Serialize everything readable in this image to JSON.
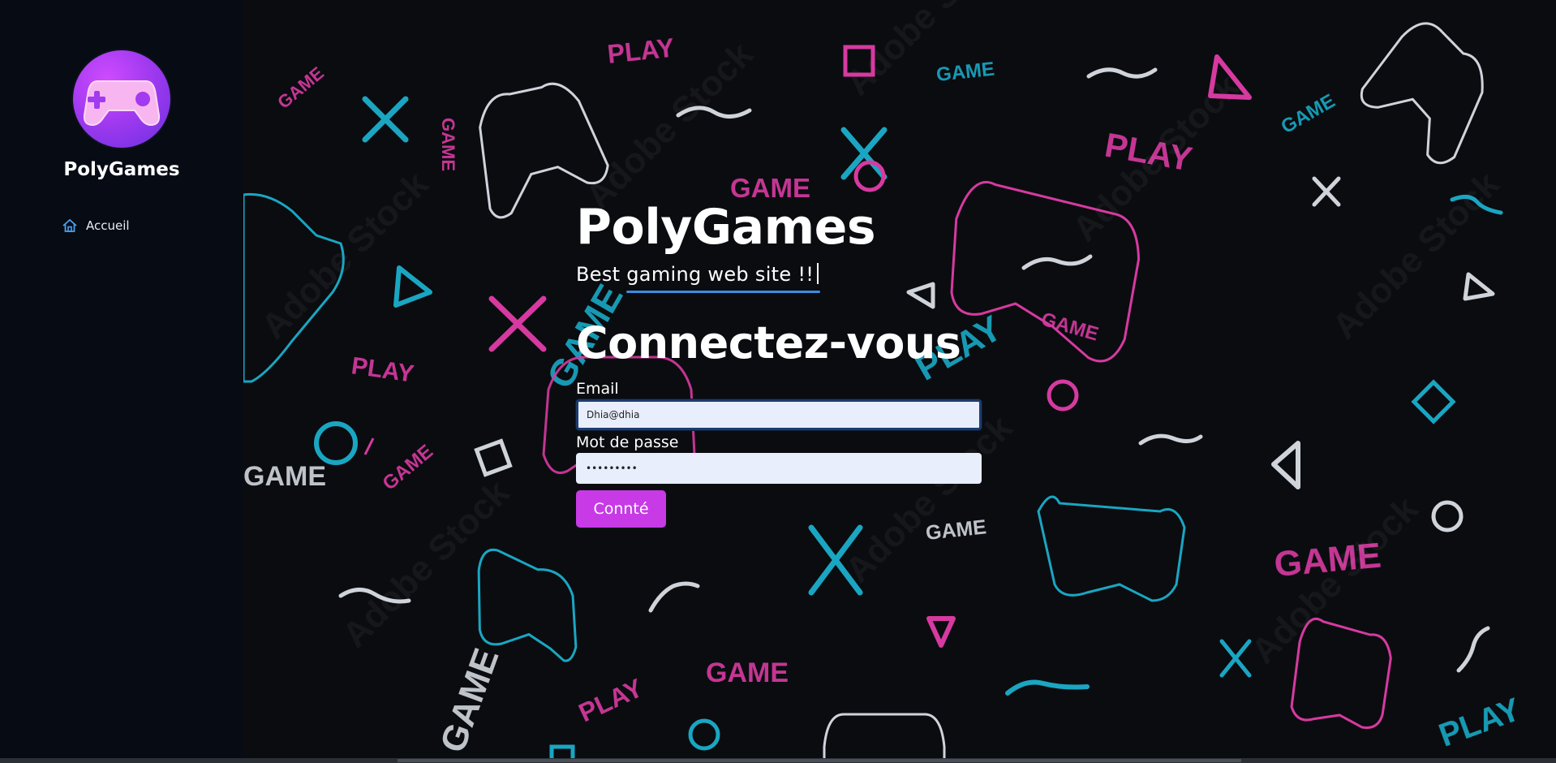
{
  "sidebar": {
    "brand": "PolyGames",
    "nav": [
      {
        "label": "Accueil",
        "icon": "home-icon"
      }
    ]
  },
  "hero": {
    "title": "PolyGames",
    "tagline": "Best gaming web site !!"
  },
  "login": {
    "heading": "Connectez-vous",
    "email_label": "Email",
    "email_value": "Dhia@dhia",
    "password_label": "Mot de passe",
    "password_value": "•••••••••",
    "submit_label": "Connté"
  },
  "background_words": {
    "play": "PLAY",
    "game": "GAME",
    "watermark": "Adobe Stock"
  },
  "colors": {
    "accent_pink": "#d63aa0",
    "accent_cyan": "#1aa6c2",
    "button": "#c73ae6",
    "underline": "#3a8ee0"
  }
}
